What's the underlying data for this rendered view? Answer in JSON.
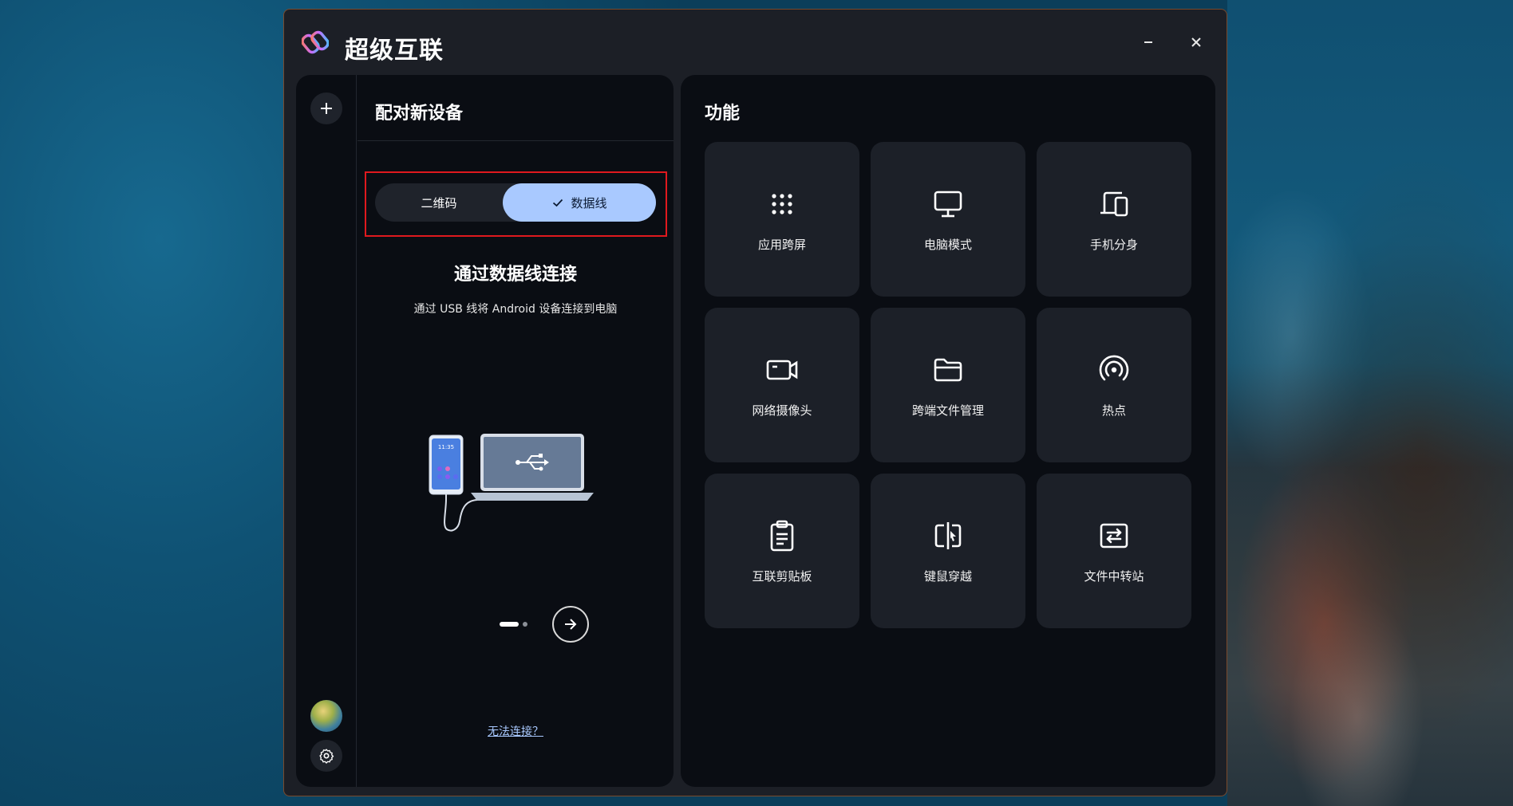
{
  "app": {
    "title": "超级互联"
  },
  "left_panel": {
    "title": "配对新设备",
    "segmented": {
      "options": [
        {
          "label": "二维码",
          "selected": false
        },
        {
          "label": "数据线",
          "selected": true
        }
      ]
    },
    "connection": {
      "title": "通过数据线连接",
      "subtitle": "通过 USB 线将 Android 设备连接到电脑"
    },
    "illustration": {
      "phone_time": "11:35"
    },
    "pager": {
      "current": 1,
      "total": 2
    },
    "help_link": "无法连接？"
  },
  "features": {
    "title": "功能",
    "items": [
      {
        "label": "应用跨屏",
        "icon": "app-grid-icon"
      },
      {
        "label": "电脑模式",
        "icon": "monitor-icon"
      },
      {
        "label": "手机分身",
        "icon": "phone-mirror-icon"
      },
      {
        "label": "网络摄像头",
        "icon": "webcam-icon"
      },
      {
        "label": "跨端文件管理",
        "icon": "folder-icon"
      },
      {
        "label": "热点",
        "icon": "hotspot-icon"
      },
      {
        "label": "互联剪贴板",
        "icon": "clipboard-icon"
      },
      {
        "label": "键鼠穿越",
        "icon": "keyboard-mouse-crossing-icon"
      },
      {
        "label": "文件中转站",
        "icon": "file-transfer-icon"
      }
    ]
  },
  "colors": {
    "accent": "#a9c9ff",
    "panel_bg": "#0a0d13",
    "card_bg": "#1c2028",
    "highlight_box": "#e0191e"
  }
}
